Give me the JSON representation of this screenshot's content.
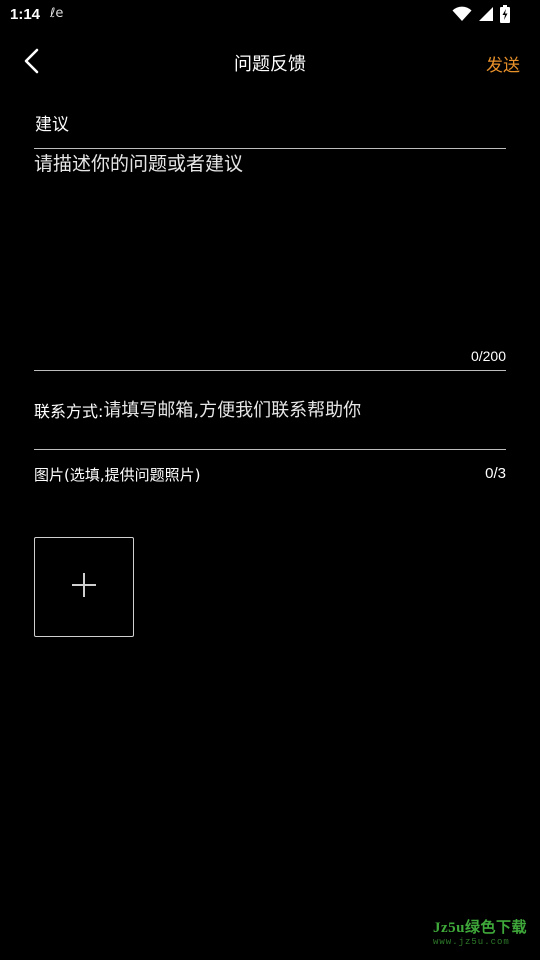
{
  "status_bar": {
    "time": "1:14",
    "extra_icon_text": "ℓe",
    "icons": [
      "wifi-icon",
      "signal-icon",
      "battery-charging-icon"
    ]
  },
  "title_bar": {
    "back_icon": "chevron-left-icon",
    "title": "问题反馈",
    "send_label": "发送"
  },
  "suggestion": {
    "section_label": "建议",
    "placeholder": "请描述你的问题或者建议",
    "value": "",
    "counter": "0/200"
  },
  "contact": {
    "label": "联系方式:",
    "placeholder": "请填写邮箱,方便我们联系帮助你",
    "value": ""
  },
  "images": {
    "label": "图片(选填,提供问题照片)",
    "counter": "0/3",
    "add_icon": "plus-icon"
  },
  "watermark": {
    "main": "Jz5u绿色下载",
    "sub": "www.jz5u.com"
  },
  "colors": {
    "background": "#000000",
    "accent": "#e8902a",
    "divider": "#bdbdbd",
    "text": "#ffffff"
  }
}
